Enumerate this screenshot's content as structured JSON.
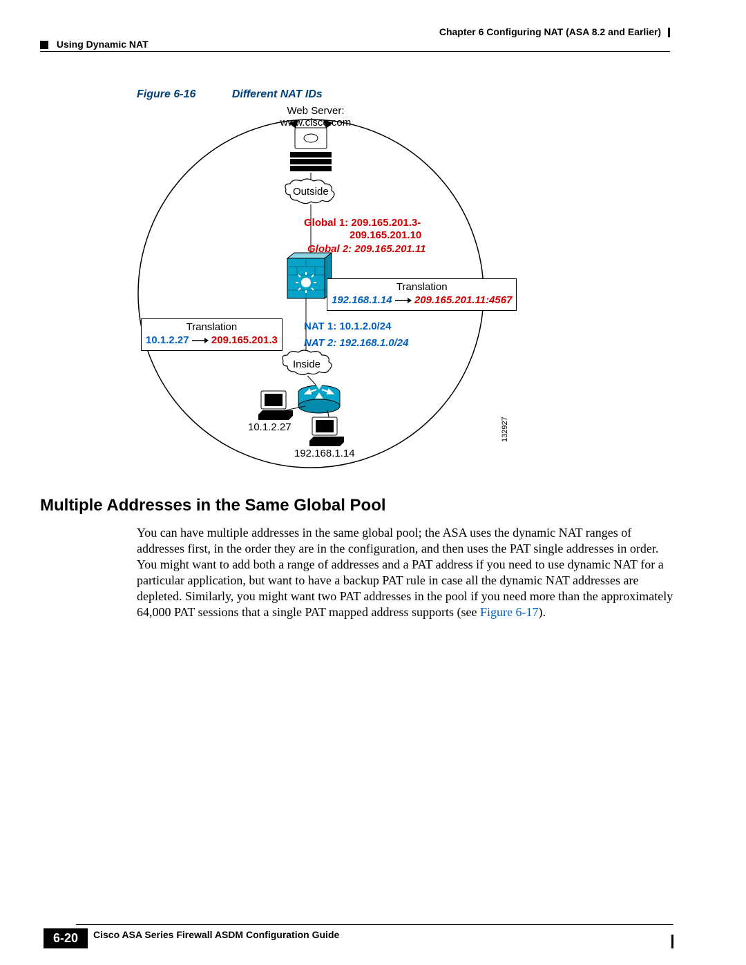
{
  "header": {
    "chapter": "Chapter 6    Configuring NAT (ASA 8.2 and Earlier)",
    "section": "Using Dynamic NAT"
  },
  "figure": {
    "label": "Figure 6-16",
    "title": "Different NAT IDs",
    "webserver_line1": "Web Server:",
    "webserver_line2": "www.cisco.com",
    "outside": "Outside",
    "inside": "Inside",
    "global1_line1": "Global 1: 209.165.201.3-",
    "global1_line2": "209.165.201.10",
    "global2": "Global 2: 209.165.201.11",
    "nat1": "NAT 1: 10.1.2.0/24",
    "nat2": "NAT 2: 192.168.1.0/24",
    "trans_right_title": "Translation",
    "trans_right_src": "192.168.1.14",
    "trans_right_dst": "209.165.201.11:4567",
    "trans_left_title": "Translation",
    "trans_left_src": "10.1.2.27",
    "trans_left_dst": "209.165.201.3",
    "host1": "10.1.2.27",
    "host2": "192.168.1.14",
    "imgcode": "132927"
  },
  "section2": {
    "heading": "Multiple Addresses in the Same Global Pool",
    "body_pre": "You can have multiple addresses in the same global pool; the ASA uses the dynamic NAT ranges of addresses first, in the order they are in the configuration, and then uses the PAT single addresses in order. You might want to add both a range of addresses and a PAT address if you need to use dynamic NAT for a particular application, but want to have a backup PAT rule in case all the dynamic NAT addresses are depleted. Similarly, you might want two PAT addresses in the pool if you need more than the approximately 64,000 PAT sessions that a single PAT mapped address supports (see ",
    "body_link": "Figure 6-17",
    "body_post": ")."
  },
  "footer": {
    "guide": "Cisco ASA Series Firewall ASDM Configuration Guide",
    "page": "6-20"
  }
}
